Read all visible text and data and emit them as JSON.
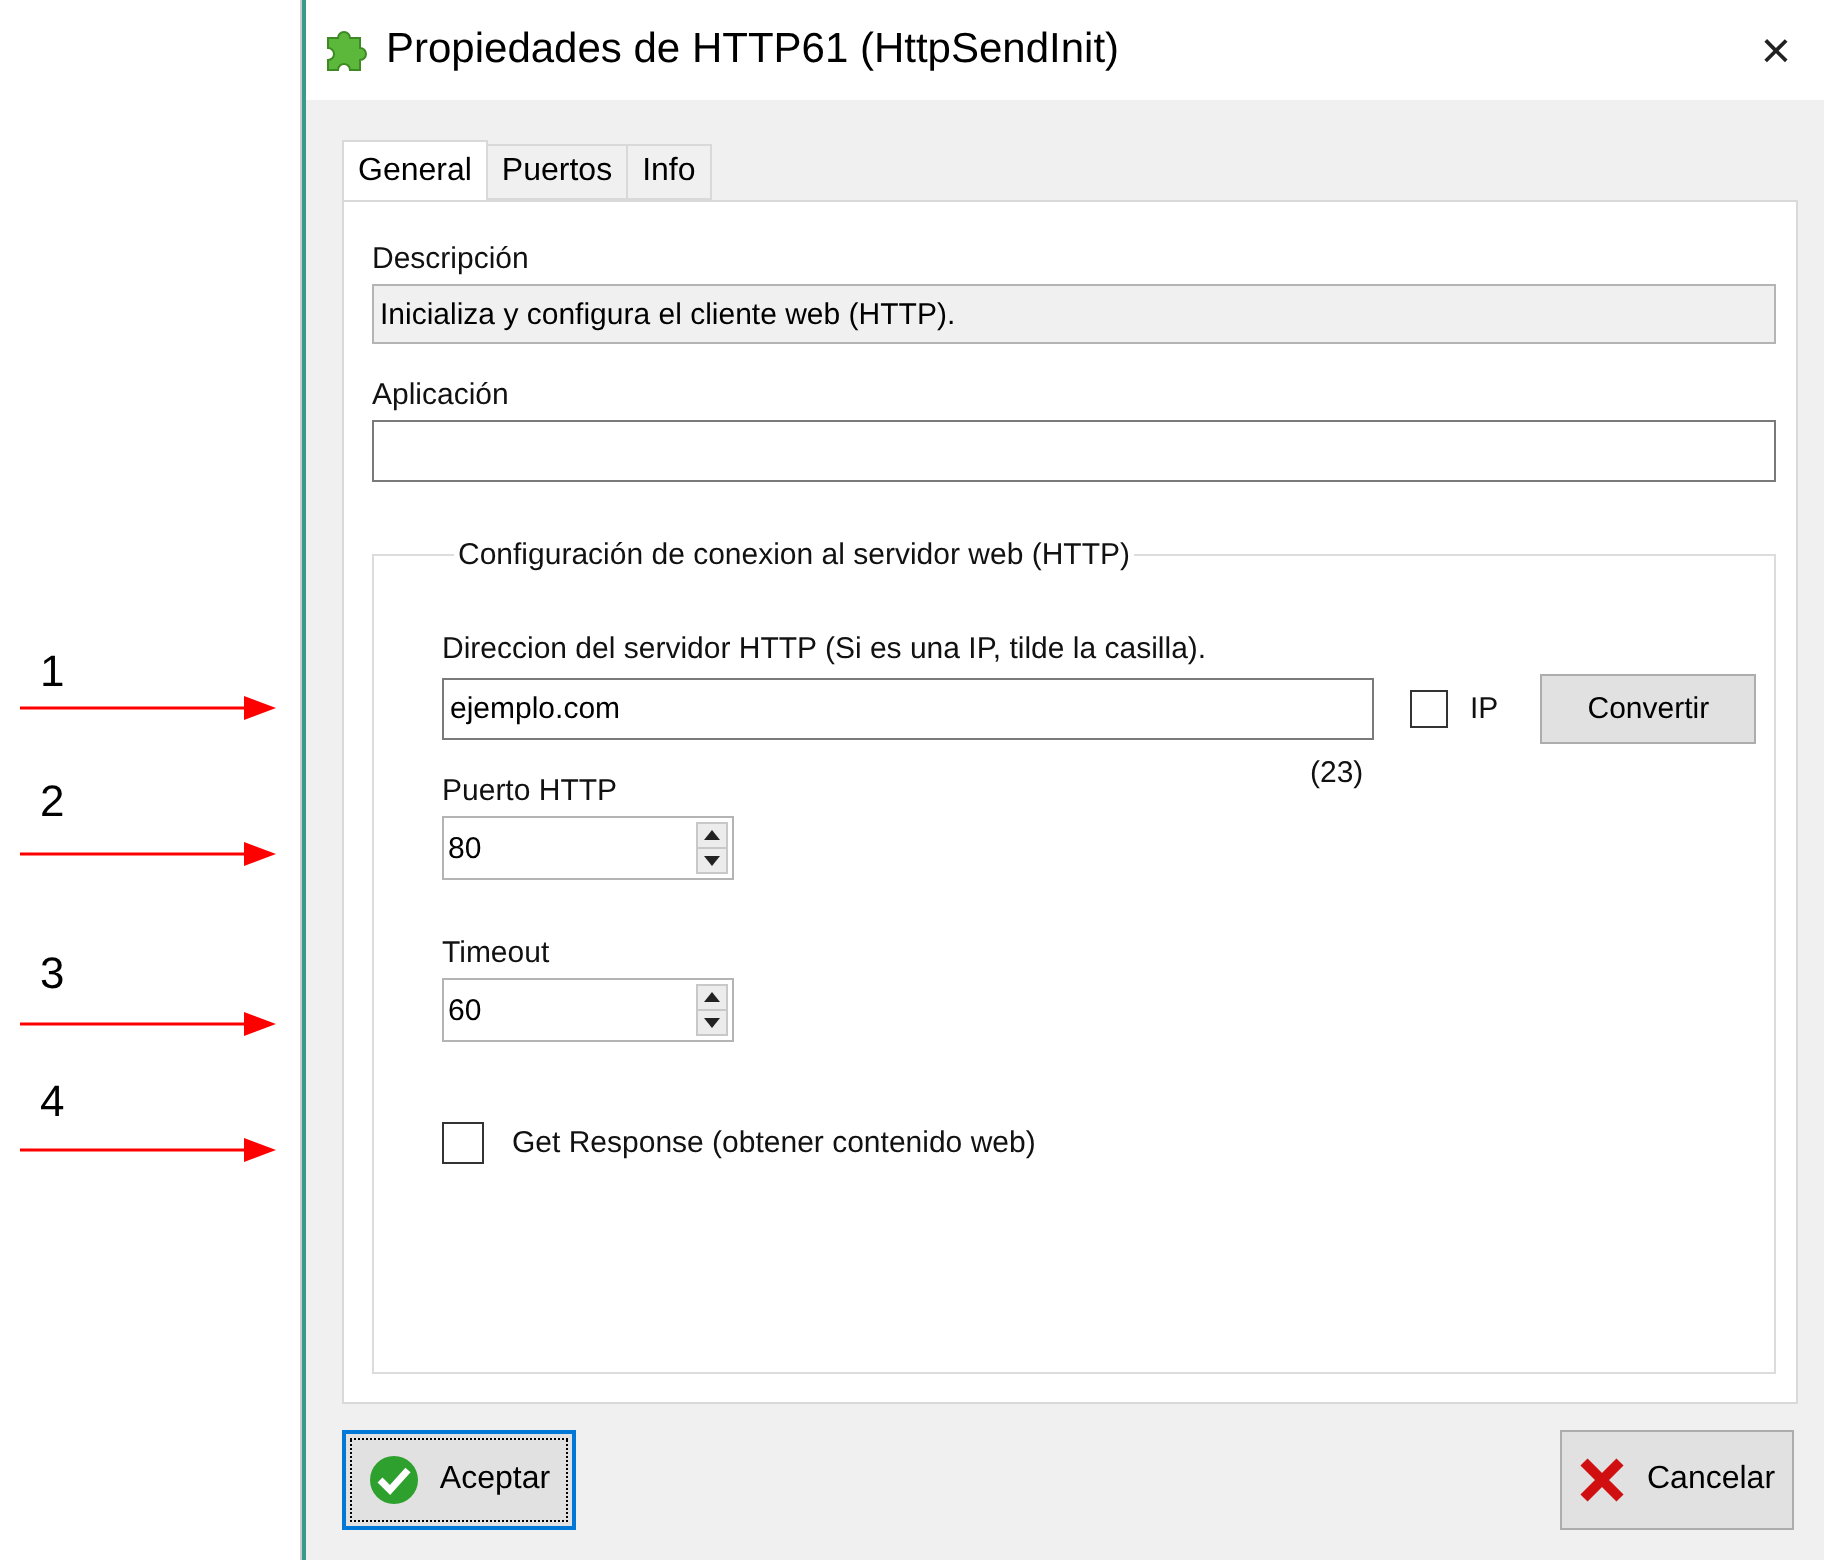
{
  "annotations": [
    {
      "number": "1"
    },
    {
      "number": "2"
    },
    {
      "number": "3"
    },
    {
      "number": "4"
    }
  ],
  "window": {
    "title": "Propiedades de HTTP61 (HttpSendInit)",
    "close": "×"
  },
  "tabs": [
    {
      "label": "General",
      "selected": true
    },
    {
      "label": "Puertos",
      "selected": false
    },
    {
      "label": "Info",
      "selected": false
    }
  ],
  "description": {
    "label": "Descripción",
    "value": "Inicializa y configura el cliente web (HTTP)."
  },
  "application": {
    "label": "Aplicación"
  },
  "group": {
    "title": "Configuración de conexion al servidor web (HTTP)",
    "server": {
      "label": "Direccion del servidor HTTP (Si es una IP, tilde la casilla).",
      "value": "ejemplo.com",
      "ip_label": "IP",
      "ip_checked": false,
      "convert_button": "Convertir",
      "count": "(23)"
    },
    "port": {
      "label": "Puerto HTTP",
      "value": "80"
    },
    "timeout": {
      "label": "Timeout",
      "value": "60"
    },
    "get_response": {
      "label": "Get Response (obtener contenido web)",
      "checked": false
    }
  },
  "buttons": [
    {
      "kind": "accept",
      "label": "Aceptar",
      "focused": true
    },
    {
      "kind": "cancel",
      "label": "Cancelar",
      "focused": false
    }
  ]
}
